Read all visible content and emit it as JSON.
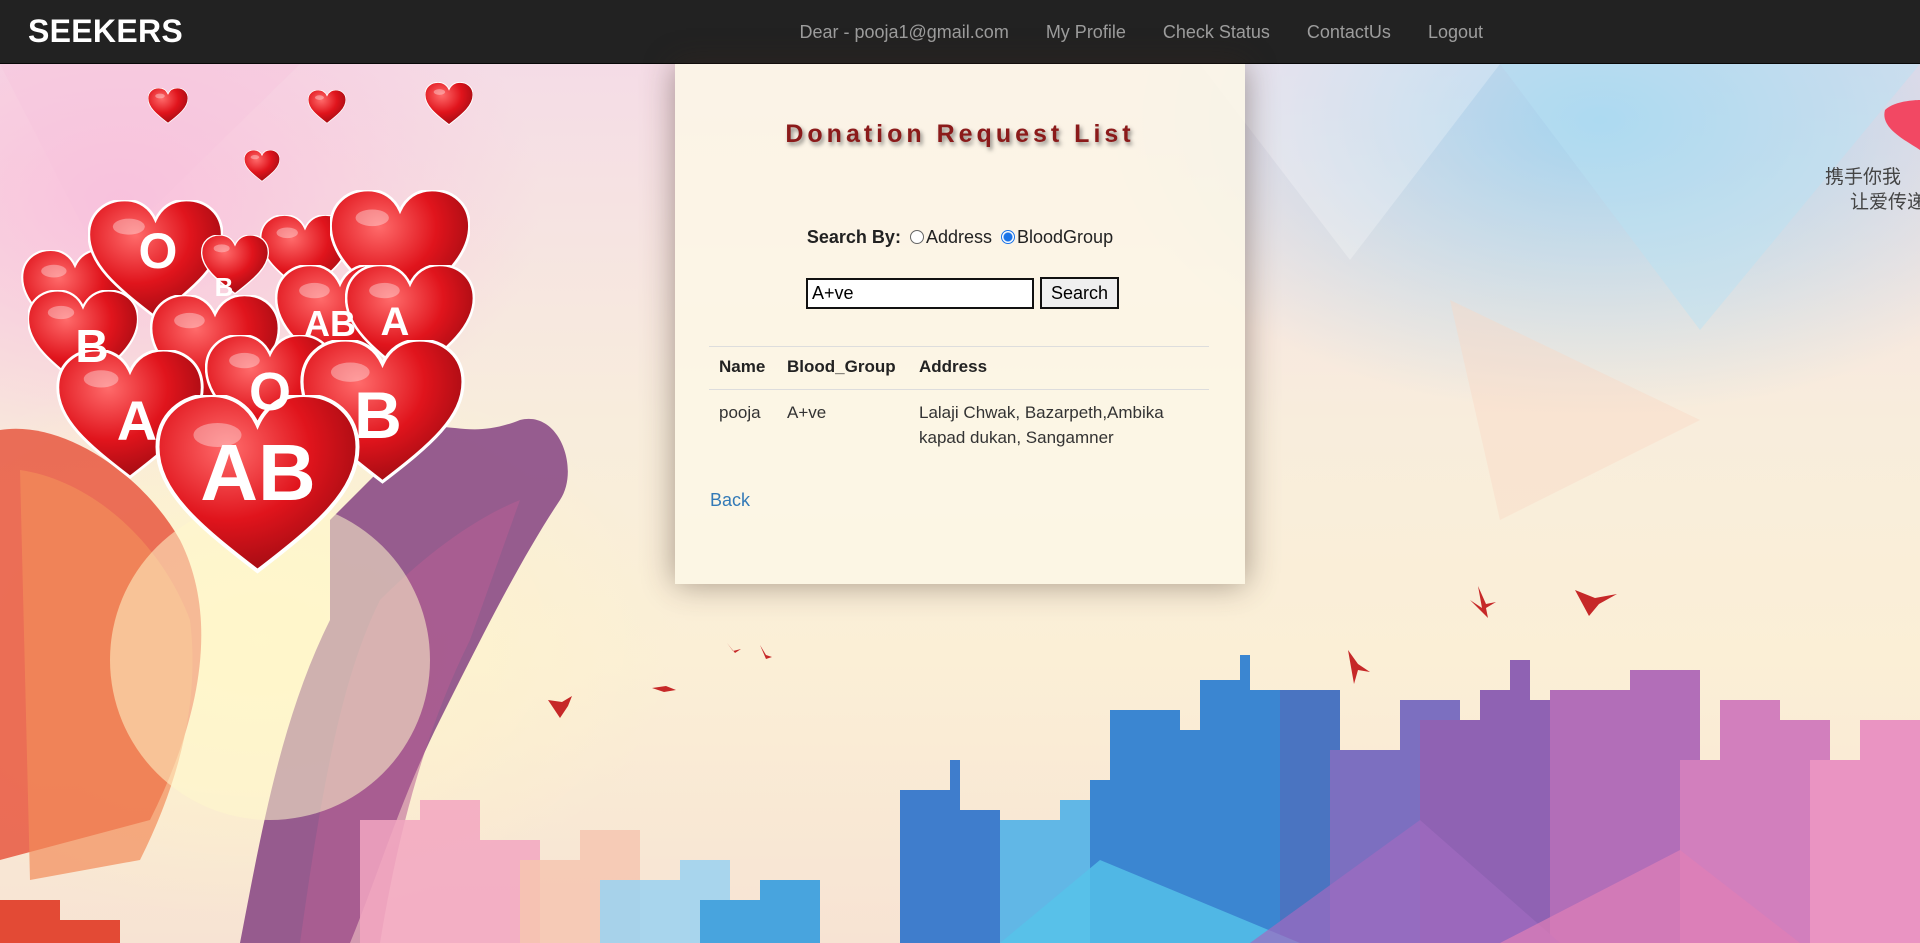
{
  "navbar": {
    "brand": "SEEKERS",
    "user_greeting": "Dear - pooja1@gmail.com",
    "links": [
      "My Profile",
      "Check Status",
      "ContactUs",
      "Logout"
    ]
  },
  "background": {
    "heart_letters": [
      "O",
      "B",
      "B",
      "A",
      "A",
      "AB",
      "O",
      "B",
      "A",
      "AB"
    ],
    "banner_text_line1": "携手你我",
    "banner_text_line2": "让爱传递"
  },
  "panel": {
    "title": "Donation Request List",
    "search_by_label": "Search By:",
    "radio_options": [
      {
        "label": "Address",
        "checked": false
      },
      {
        "label": "BloodGroup",
        "checked": true
      }
    ],
    "search_value": "A+ve",
    "search_button": "Search",
    "table": {
      "headers": [
        "Name",
        "Blood_Group",
        "Address"
      ],
      "rows": [
        [
          "pooja",
          "A+ve",
          "Lalaji Chwak, Bazarpeth,Ambika kapad dukan, Sangamner"
        ]
      ]
    },
    "back_link": "Back"
  },
  "colors": {
    "navbar_bg": "#222222",
    "nav_link": "#9d9d9d",
    "title": "#8b1a1a",
    "link": "#337ab7"
  }
}
